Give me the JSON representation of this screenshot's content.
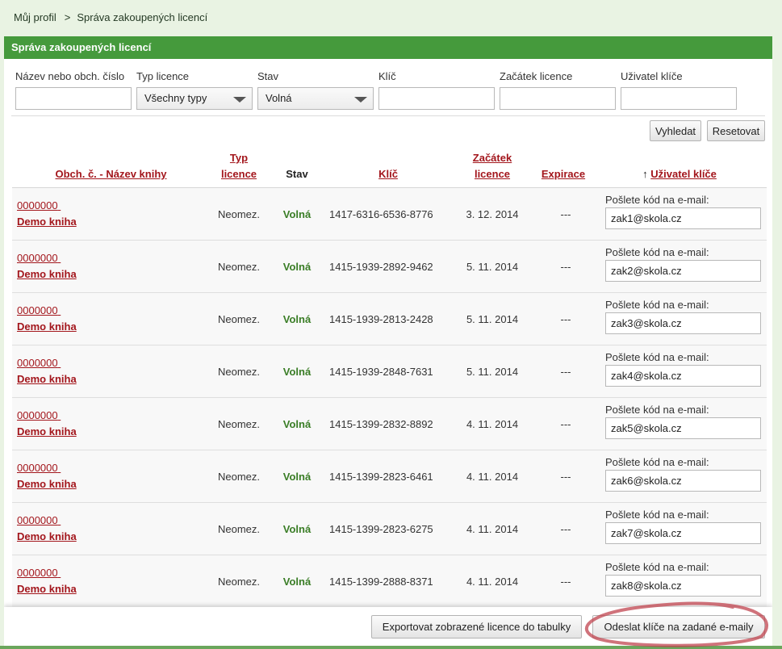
{
  "breadcrumb": {
    "home": "Můj profil",
    "separator": ">",
    "current": "Správa zakoupených licencí"
  },
  "panel": {
    "title": "Správa zakoupených licencí"
  },
  "filters": {
    "name": {
      "label": "Název nebo obch. číslo",
      "value": ""
    },
    "type": {
      "label": "Typ licence",
      "value": "Všechny typy"
    },
    "status": {
      "label": "Stav",
      "value": "Volná"
    },
    "key": {
      "label": "Klíč",
      "value": ""
    },
    "start": {
      "label": "Začátek licence",
      "value": ""
    },
    "user": {
      "label": "Uživatel klíče",
      "value": ""
    }
  },
  "buttons": {
    "search": "Vyhledat",
    "reset": "Resetovat",
    "export": "Exportovat zobrazené licence do tabulky",
    "send": "Odeslat klíče na zadané e-maily"
  },
  "table": {
    "headers": {
      "book": "Obch. č. - Název knihy",
      "type_line1": "Typ",
      "type_line2": "licence",
      "status": "Stav",
      "key": "Klíč",
      "start_line1": "Začátek",
      "start_line2": "licence",
      "expiration": "Expirace",
      "sort_arrow": "↑",
      "user": "Uživatel klíče"
    },
    "email_label": "Pošlete kód na e-mail:",
    "rows": [
      {
        "code": "0000000",
        "title": "Demo kniha",
        "type": "Neomez.",
        "status": "Volná",
        "key": "1417-6316-6536-8776",
        "start": "3. 12. 2014",
        "expiration": "---",
        "email": "zak1@skola.cz"
      },
      {
        "code": "0000000",
        "title": "Demo kniha",
        "type": "Neomez.",
        "status": "Volná",
        "key": "1415-1939-2892-9462",
        "start": "5. 11. 2014",
        "expiration": "---",
        "email": "zak2@skola.cz"
      },
      {
        "code": "0000000",
        "title": "Demo kniha",
        "type": "Neomez.",
        "status": "Volná",
        "key": "1415-1939-2813-2428",
        "start": "5. 11. 2014",
        "expiration": "---",
        "email": "zak3@skola.cz"
      },
      {
        "code": "0000000",
        "title": "Demo kniha",
        "type": "Neomez.",
        "status": "Volná",
        "key": "1415-1939-2848-7631",
        "start": "5. 11. 2014",
        "expiration": "---",
        "email": "zak4@skola.cz"
      },
      {
        "code": "0000000",
        "title": "Demo kniha",
        "type": "Neomez.",
        "status": "Volná",
        "key": "1415-1399-2832-8892",
        "start": "4. 11. 2014",
        "expiration": "---",
        "email": "zak5@skola.cz"
      },
      {
        "code": "0000000",
        "title": "Demo kniha",
        "type": "Neomez.",
        "status": "Volná",
        "key": "1415-1399-2823-6461",
        "start": "4. 11. 2014",
        "expiration": "---",
        "email": "zak6@skola.cz"
      },
      {
        "code": "0000000",
        "title": "Demo kniha",
        "type": "Neomez.",
        "status": "Volná",
        "key": "1415-1399-2823-6275",
        "start": "4. 11. 2014",
        "expiration": "---",
        "email": "zak7@skola.cz"
      },
      {
        "code": "0000000",
        "title": "Demo kniha",
        "type": "Neomez.",
        "status": "Volná",
        "key": "1415-1399-2888-8371",
        "start": "4. 11. 2014",
        "expiration": "---",
        "email": "zak8@skola.cz"
      }
    ]
  },
  "colors": {
    "header_green": "#459a3c",
    "link_red": "#a3161c",
    "status_green": "#3a7d26",
    "annotation_red": "#c0444f"
  }
}
